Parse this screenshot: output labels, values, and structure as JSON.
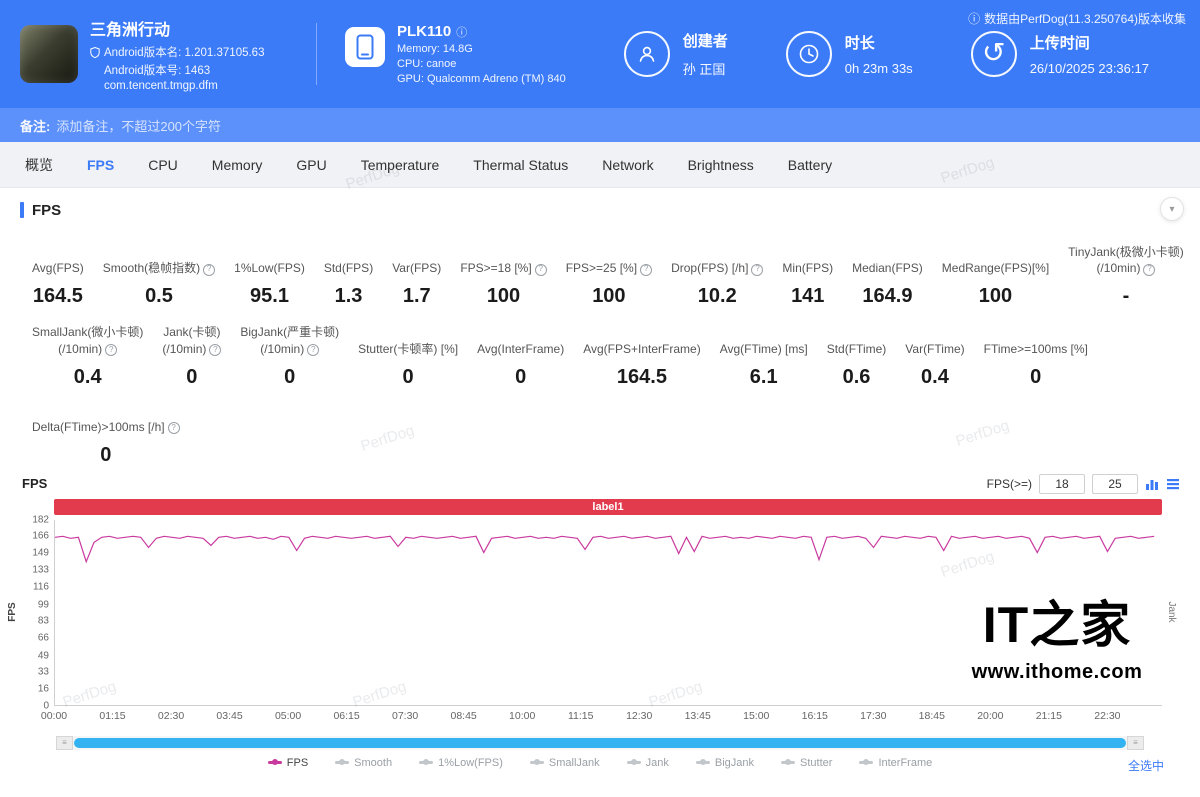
{
  "icons": {
    "info": "ⓘ",
    "help": "?",
    "collapse": "▾",
    "handle": "≡",
    "history": "↺"
  },
  "watermark": "PerfDog",
  "header": {
    "collect_note": "数据由PerfDog(11.3.250764)版本收集",
    "game": {
      "name": "三角洲行动",
      "version_name": "Android版本名: 1.201.37105.63",
      "version_code": "Android版本号: 1463",
      "package": "com.tencent.tmgp.dfm"
    },
    "device": {
      "model": "PLK110",
      "memory": "Memory: 14.8G",
      "cpu": "CPU: canoe",
      "gpu": "GPU: Qualcomm Adreno (TM) 840"
    },
    "creator": {
      "label": "创建者",
      "value": "孙 正国"
    },
    "duration": {
      "label": "时长",
      "value": "0h 23m 33s"
    },
    "upload": {
      "label": "上传时间",
      "value": "26/10/2025 23:36:17"
    }
  },
  "note_bar": {
    "prefix": "备注:",
    "text": "添加备注，不超过200个字符"
  },
  "tabs": [
    {
      "id": "overview",
      "label": "概览",
      "active": false
    },
    {
      "id": "fps",
      "label": "FPS",
      "active": true
    },
    {
      "id": "cpu",
      "label": "CPU",
      "active": false
    },
    {
      "id": "memory",
      "label": "Memory",
      "active": false
    },
    {
      "id": "gpu",
      "label": "GPU",
      "active": false
    },
    {
      "id": "temperature",
      "label": "Temperature",
      "active": false
    },
    {
      "id": "thermal-status",
      "label": "Thermal Status",
      "active": false
    },
    {
      "id": "network",
      "label": "Network",
      "active": false
    },
    {
      "id": "brightness",
      "label": "Brightness",
      "active": false
    },
    {
      "id": "battery",
      "label": "Battery",
      "active": false
    }
  ],
  "section": {
    "title": "FPS"
  },
  "stats": {
    "row1": [
      {
        "id": "avg-fps",
        "label": "Avg(FPS)",
        "value": "164.5"
      },
      {
        "id": "smooth",
        "label": "Smooth(稳帧指数)",
        "help": true,
        "value": "0.5"
      },
      {
        "id": "low1pct",
        "label": "1%Low(FPS)",
        "value": "95.1"
      },
      {
        "id": "std-fps",
        "label": "Std(FPS)",
        "value": "1.3"
      },
      {
        "id": "var-fps",
        "label": "Var(FPS)",
        "value": "1.7"
      },
      {
        "id": "fps-ge-18",
        "label": "FPS>=18 [%]",
        "help": true,
        "value": "100"
      },
      {
        "id": "fps-ge-25",
        "label": "FPS>=25 [%]",
        "help": true,
        "value": "100"
      },
      {
        "id": "drop-fps",
        "label": "Drop(FPS) [/h]",
        "help": true,
        "value": "10.2"
      },
      {
        "id": "min-fps",
        "label": "Min(FPS)",
        "value": "141"
      },
      {
        "id": "median-fps",
        "label": "Median(FPS)",
        "value": "164.9"
      },
      {
        "id": "medrange-fps",
        "label": "MedRange(FPS)[%]",
        "value": "100"
      },
      {
        "id": "tinyjank",
        "label": "TinyJank(极微小卡顿)",
        "label2": "(/10min)",
        "help": true,
        "value": "-"
      }
    ],
    "row2": [
      {
        "id": "smalljank",
        "label": "SmallJank(微小卡顿)",
        "label2": "(/10min)",
        "help": true,
        "value": "0.4"
      },
      {
        "id": "jank",
        "label": "Jank(卡顿)",
        "label2": "(/10min)",
        "help": true,
        "value": "0"
      },
      {
        "id": "bigjank",
        "label": "BigJank(严重卡顿)",
        "label2": "(/10min)",
        "help": true,
        "value": "0"
      },
      {
        "id": "stutter",
        "label": "Stutter(卡顿率) [%]",
        "value": "0"
      },
      {
        "id": "avg-interframe",
        "label": "Avg(InterFrame)",
        "value": "0"
      },
      {
        "id": "avg-fps-interframe",
        "label": "Avg(FPS+InterFrame)",
        "value": "164.5"
      },
      {
        "id": "avg-ftime",
        "label": "Avg(FTime) [ms]",
        "value": "6.1"
      },
      {
        "id": "std-ftime",
        "label": "Std(FTime)",
        "value": "0.6"
      },
      {
        "id": "var-ftime",
        "label": "Var(FTime)",
        "value": "0.4"
      },
      {
        "id": "ftime-ge-100ms",
        "label": "FTime>=100ms [%]",
        "value": "0"
      }
    ],
    "row3": [
      {
        "id": "delta-ftime",
        "label": "Delta(FTime)>100ms [/h]",
        "help": true,
        "value": "0"
      }
    ]
  },
  "chart": {
    "title_left": "FPS",
    "threshold_label": "FPS(>=)",
    "threshold1": "18",
    "threshold2": "25",
    "label_bar": "label1"
  },
  "chart_data": {
    "type": "line",
    "title": "label1",
    "ylabel": "FPS",
    "ylabel_right": "Jank",
    "ylim": [
      0,
      182
    ],
    "y_ticks": [
      182,
      166,
      149,
      133,
      116,
      99,
      83,
      66,
      49,
      33,
      16,
      0
    ],
    "x_ticks": [
      "00:00",
      "01:15",
      "02:30",
      "03:45",
      "05:00",
      "06:15",
      "07:30",
      "08:45",
      "10:00",
      "11:15",
      "12:30",
      "13:45",
      "15:00",
      "16:15",
      "17:30",
      "18:45",
      "20:00",
      "21:15",
      "22:30"
    ],
    "x_max_s": 1420,
    "series": [
      {
        "name": "FPS",
        "color": "#c93a9f",
        "sample_interval_s": 10,
        "values": [
          165,
          166,
          164,
          165,
          141,
          160,
          165,
          166,
          164,
          165,
          166,
          165,
          155,
          164,
          166,
          165,
          164,
          166,
          165,
          164,
          157,
          165,
          166,
          164,
          165,
          166,
          164,
          165,
          163,
          166,
          165,
          152,
          164,
          166,
          165,
          164,
          166,
          165,
          164,
          165,
          166,
          164,
          165,
          166,
          156,
          165,
          164,
          166,
          165,
          164,
          165,
          166,
          164,
          165,
          166,
          150,
          164,
          165,
          166,
          164,
          165,
          166,
          164,
          165,
          164,
          166,
          165,
          164,
          153,
          165,
          166,
          164,
          165,
          166,
          164,
          165,
          166,
          164,
          165,
          166,
          149,
          165,
          151,
          166,
          164,
          165,
          166,
          164,
          165,
          164,
          166,
          165,
          164,
          166,
          165,
          164,
          166,
          165,
          143,
          165,
          166,
          164,
          165,
          166,
          164,
          155,
          166,
          165,
          164,
          166,
          165,
          164,
          166,
          165,
          152,
          166,
          164,
          165,
          166,
          164,
          165,
          166,
          164,
          165,
          166,
          164,
          150,
          165,
          166,
          164,
          165,
          166,
          164,
          165,
          166,
          151,
          164,
          165,
          166,
          164,
          165,
          166
        ]
      }
    ]
  },
  "legend": {
    "items": [
      {
        "id": "fps",
        "label": "FPS",
        "color": "#c93a9f",
        "selected": true
      },
      {
        "id": "smooth",
        "label": "Smooth",
        "color": "#c2c7cc",
        "selected": false
      },
      {
        "id": "low1pct",
        "label": "1%Low(FPS)",
        "color": "#c2c7cc",
        "selected": false
      },
      {
        "id": "smalljank",
        "label": "SmallJank",
        "color": "#c2c7cc",
        "selected": false
      },
      {
        "id": "jank",
        "label": "Jank",
        "color": "#c2c7cc",
        "selected": false
      },
      {
        "id": "bigjank",
        "label": "BigJank",
        "color": "#c2c7cc",
        "selected": false
      },
      {
        "id": "stutter",
        "label": "Stutter",
        "color": "#c2c7cc",
        "selected": false
      },
      {
        "id": "interframe",
        "label": "InterFrame",
        "color": "#c2c7cc",
        "selected": false
      }
    ],
    "select_all": "全选中"
  },
  "logo": {
    "brand_latin": "IT",
    "brand_cn": "之家",
    "url": "www.ithome.com"
  }
}
